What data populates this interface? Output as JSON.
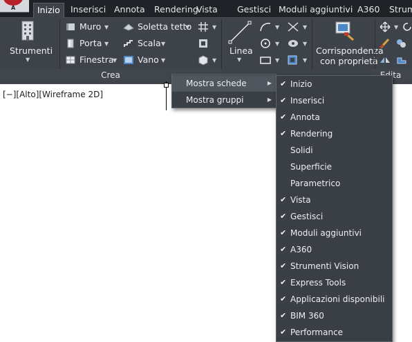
{
  "app": {
    "letter": "A"
  },
  "tabs": [
    "Inizio",
    "Inserisci",
    "Annota",
    "Rendering",
    "Vista",
    "Gestisci",
    "Moduli aggiuntivi",
    "A360",
    "Strum"
  ],
  "ribbon": {
    "tools_label": "Strumenti",
    "wall_label": "Muro",
    "door_label": "Porta",
    "window_label": "Finestra",
    "slab_label": "Soletta tetto",
    "stair_label": "Scala",
    "opening_label": "Vano",
    "line_label": "Linea",
    "matchprop_label_1": "Corrispondenza",
    "matchprop_label_2": "con proprietà",
    "create_panel_title": "Crea",
    "edit_panel_title": "Edita"
  },
  "viewport": {
    "label": "[−][Alto][Wireframe 2D]"
  },
  "context_menu": {
    "items": [
      {
        "label": "Mostra schede",
        "has_submenu": true,
        "selected": true
      },
      {
        "label": "Mostra gruppi",
        "has_submenu": true,
        "selected": false
      }
    ]
  },
  "submenu": {
    "check_glyph": "✔",
    "items": [
      {
        "label": "Inizio",
        "checked": true
      },
      {
        "label": "Inserisci",
        "checked": true
      },
      {
        "label": "Annota",
        "checked": true
      },
      {
        "label": "Rendering",
        "checked": true
      },
      {
        "label": "Solidi",
        "checked": false
      },
      {
        "label": "Superficie",
        "checked": false
      },
      {
        "label": "Parametrico",
        "checked": false
      },
      {
        "label": "Vista",
        "checked": true
      },
      {
        "label": "Gestisci",
        "checked": true
      },
      {
        "label": "Moduli aggiuntivi",
        "checked": true
      },
      {
        "label": "A360",
        "checked": true
      },
      {
        "label": "Strumenti Vision",
        "checked": true
      },
      {
        "label": "Express Tools",
        "checked": true
      },
      {
        "label": "Applicazioni disponibili",
        "checked": true
      },
      {
        "label": "BIM 360",
        "checked": true
      },
      {
        "label": "Performance",
        "checked": true
      }
    ]
  },
  "colors": {
    "ribbon_bg": "#3d4349",
    "tabstrip_bg": "#1f2327",
    "menu_bg": "#393f45",
    "menu_hover": "#4f565d",
    "brand_red": "#b8202a"
  }
}
